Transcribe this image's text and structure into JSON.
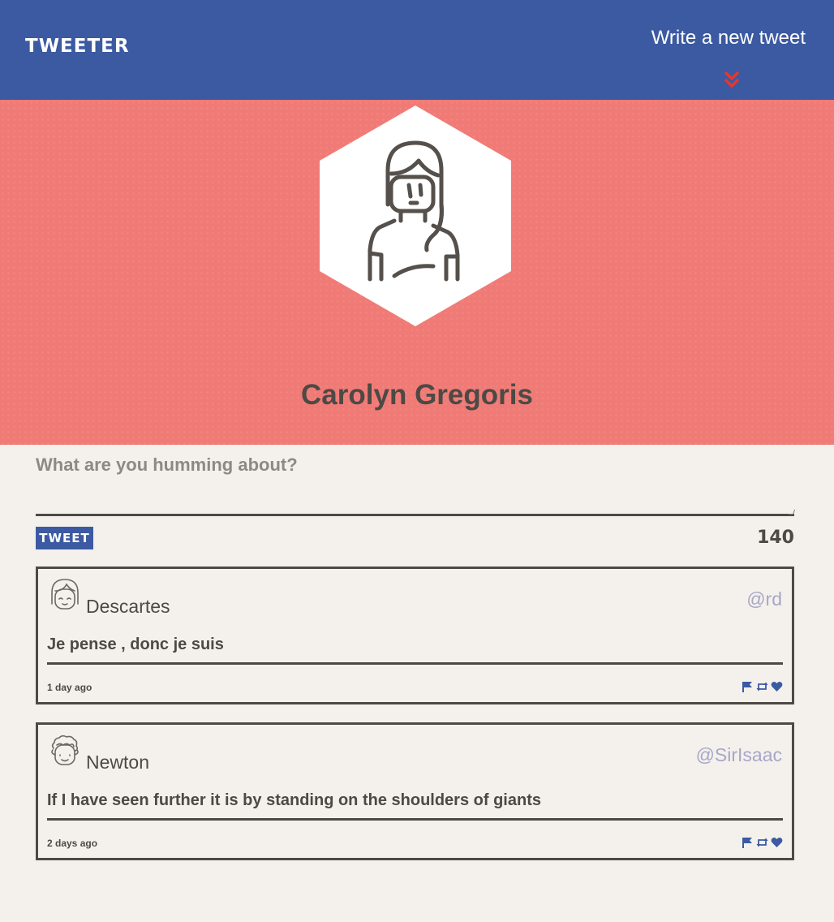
{
  "nav": {
    "logo": "TWEETER",
    "compose_link": "Write a new tweet",
    "chevron_icon": "double-chevron-down-icon",
    "accent_color": "#e8362a"
  },
  "profile": {
    "name": "Carolyn Gregoris",
    "avatar_icon": "woman-avatar-icon"
  },
  "composer": {
    "placeholder": "What are you humming about?",
    "value": "",
    "button_label": "TWEET",
    "char_count": "140"
  },
  "tweets": [
    {
      "author": "Descartes",
      "handle": "@rd",
      "text": "Je pense , donc je suis",
      "time": "1 day ago",
      "avatar_icon": "girl-avatar-icon"
    },
    {
      "author": "Newton",
      "handle": "@SirIsaac",
      "text": "If I have seen further it is by standing on the shoulders of giants",
      "time": "2 days ago",
      "avatar_icon": "curly-hair-avatar-icon"
    }
  ],
  "actions": [
    "flag-icon",
    "retweet-icon",
    "heart-icon"
  ],
  "colors": {
    "nav": "#3c5aa2",
    "hero": "#f07b76",
    "background": "#f4f1ec",
    "text": "#4d4945",
    "handle": "#a8a6c8"
  }
}
